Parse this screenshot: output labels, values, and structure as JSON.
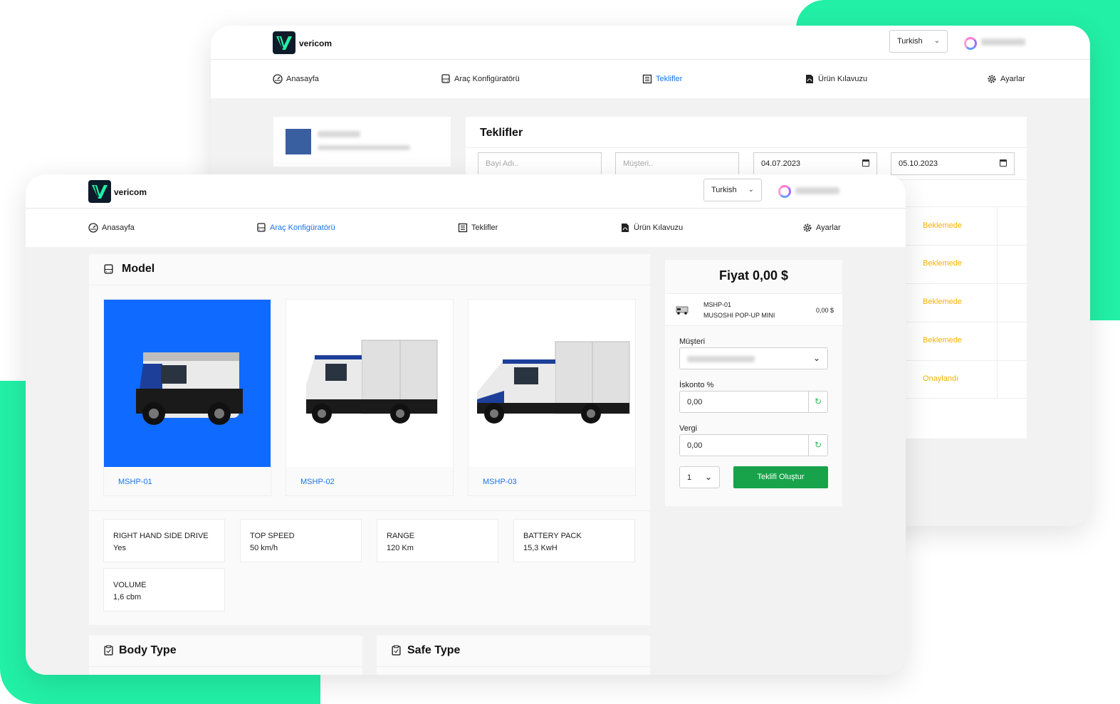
{
  "back_window": {
    "brand": "vericom",
    "language": "Turkish",
    "nav": [
      {
        "label": "Anasayfa",
        "icon": "dashboard-icon"
      },
      {
        "label": "Araç Konfigüratörü",
        "icon": "bus-icon"
      },
      {
        "label": "Teklifler",
        "icon": "document-list-icon"
      },
      {
        "label": "Ürün Kılavuzu",
        "icon": "pdf-icon"
      },
      {
        "label": "Ayarlar",
        "icon": "gear-icon"
      }
    ],
    "active_nav": "Teklifler",
    "offers": {
      "title": "Teklifler",
      "filters": {
        "dealer_placeholder": "Bayi Adı..",
        "customer_placeholder": "Müşteri..",
        "date_from": "04.07.2023",
        "date_to": "05.10.2023"
      },
      "statuses": [
        "Beklemede",
        "Beklemede",
        "Beklemede",
        "Beklemede",
        "Onaylandı"
      ]
    }
  },
  "front_window": {
    "brand": "vericom",
    "language": "Turkish",
    "nav": [
      {
        "label": "Anasayfa",
        "icon": "dashboard-icon"
      },
      {
        "label": "Araç Konfigüratörü",
        "icon": "bus-icon"
      },
      {
        "label": "Teklifler",
        "icon": "document-list-icon"
      },
      {
        "label": "Ürün Kılavuzu",
        "icon": "pdf-icon"
      },
      {
        "label": "Ayarlar",
        "icon": "gear-icon"
      }
    ],
    "active_nav": "Araç Konfigüratörü",
    "model_section": {
      "title": "Model",
      "vehicles": [
        {
          "label": "MSHP-01",
          "selected": true
        },
        {
          "label": "MSHP-02",
          "selected": false
        },
        {
          "label": "MSHP-03",
          "selected": false
        }
      ],
      "specs": [
        {
          "name": "RIGHT HAND SIDE DRIVE",
          "value": "Yes"
        },
        {
          "name": "TOP SPEED",
          "value": "50 km/h"
        },
        {
          "name": "RANGE",
          "value": "120 Km"
        },
        {
          "name": "BATTERY PACK",
          "value": "15,3 KwH"
        },
        {
          "name": "VOLUME",
          "value": "1,6 cbm"
        }
      ]
    },
    "body_type_title": "Body Type",
    "safe_type_title": "Safe Type",
    "price_panel": {
      "title": "Fiyat 0,00 $",
      "item_code": "MSHP-01",
      "item_name": "MUSOSHI POP-UP MINI",
      "item_price": "0,00 $",
      "customer_label": "Müşteri",
      "discount_label": "İskonto %",
      "discount_value": "0,00",
      "tax_label": "Vergi",
      "tax_value": "0,00",
      "quantity": "1",
      "create_button": "Teklifi Oluştur"
    },
    "colors": {
      "accent": "#1a73e8",
      "brand_green": "#22f0a6",
      "button_green": "#18a34a",
      "pending": "#f5b400",
      "approved": "#f5b400",
      "selected_bg": "#0f6bff"
    }
  }
}
